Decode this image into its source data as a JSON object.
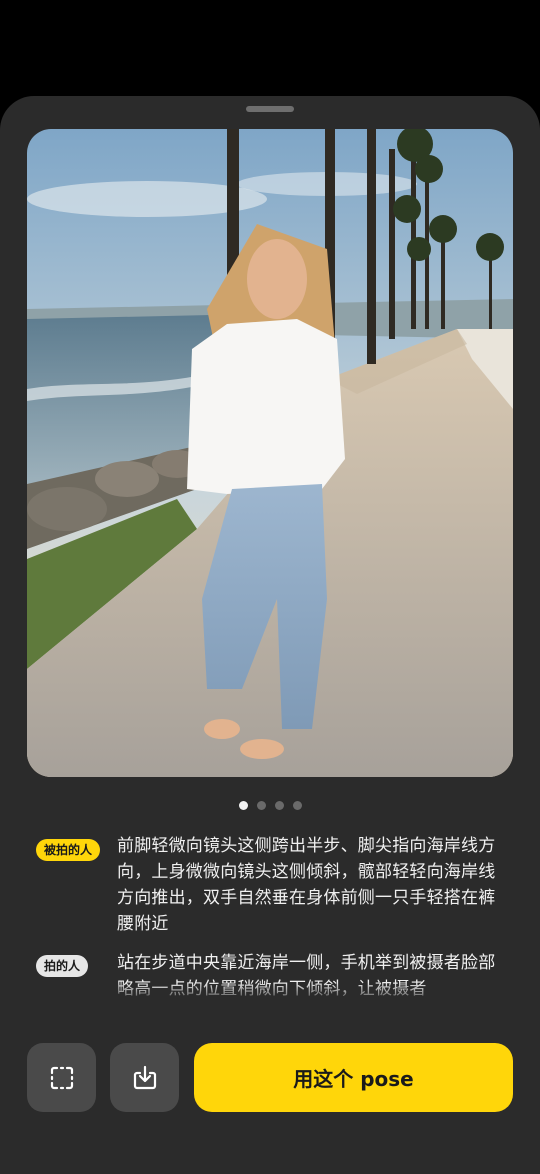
{
  "carousel": {
    "page_count": 4,
    "active_index": 0
  },
  "tips": [
    {
      "role": "被拍的人",
      "text": "前脚轻微向镜头这侧跨出半步、脚尖指向海岸线方向，上身微微向镜头这侧倾斜，髋部轻轻向海岸线方向推出，双手自然垂在身体前侧一只手轻搭在裤腰附近",
      "badge_color": "#ffd60a"
    },
    {
      "role": "拍的人",
      "text": "站在步道中央靠近海岸一侧，手机举到被摄者脸部略高一点的位置稍微向下倾斜，让被摄者",
      "badge_color": "#e6e6e6"
    }
  ],
  "actions": {
    "crop_icon": "crop-frame-icon",
    "save_icon": "download-icon",
    "primary_label": "用这个 pose"
  },
  "colors": {
    "accent": "#ffd60a",
    "sheet": "#2b2b2b"
  }
}
